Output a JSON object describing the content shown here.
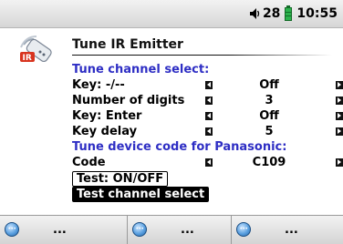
{
  "status": {
    "volume": "28",
    "time": "10:55"
  },
  "screen": {
    "title": "Tune IR Emitter",
    "app_icon": "ir-remote-icon"
  },
  "rows": [
    {
      "type": "section",
      "label": "Tune channel select:"
    },
    {
      "type": "setting",
      "label": "Key: -/--",
      "value": "Off"
    },
    {
      "type": "setting",
      "label": "Number of digits",
      "value": "3"
    },
    {
      "type": "setting",
      "label": "Key: Enter",
      "value": "Off"
    },
    {
      "type": "setting",
      "label": "Key delay",
      "value": "5"
    },
    {
      "type": "section",
      "label": "Tune device code for Panasonic:"
    },
    {
      "type": "setting",
      "label": "Code",
      "value": "C109"
    }
  ],
  "buttons": {
    "test_onoff": "Test: ON/OFF",
    "test_channel": "Test channel select"
  },
  "softkeys": [
    "...",
    "...",
    "..."
  ],
  "icons": {
    "left_arrow": "left-arrow-icon",
    "right_arrow": "right-arrow-icon",
    "softkey": "softkey-dot-icon"
  },
  "colors": {
    "section_heading": "#2e2ec4",
    "battery": "#2bb24c",
    "selected_button_bg": "#000000"
  }
}
